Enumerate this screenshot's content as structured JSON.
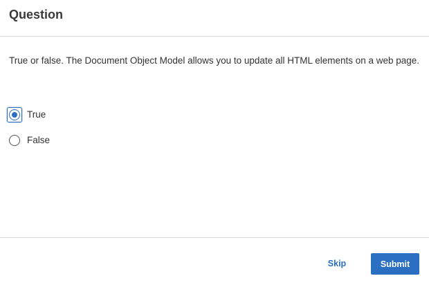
{
  "dialog": {
    "title": "Question",
    "question": "True or false. The Document Object Model allows you to update all HTML elements on a web page.",
    "options": [
      {
        "label": "True",
        "selected": true
      },
      {
        "label": "False",
        "selected": false
      }
    ],
    "footer": {
      "skip_label": "Skip",
      "submit_label": "Submit"
    }
  },
  "colors": {
    "accent": "#2b6fc2",
    "text": "#333333",
    "divider": "#dcdcdc"
  }
}
